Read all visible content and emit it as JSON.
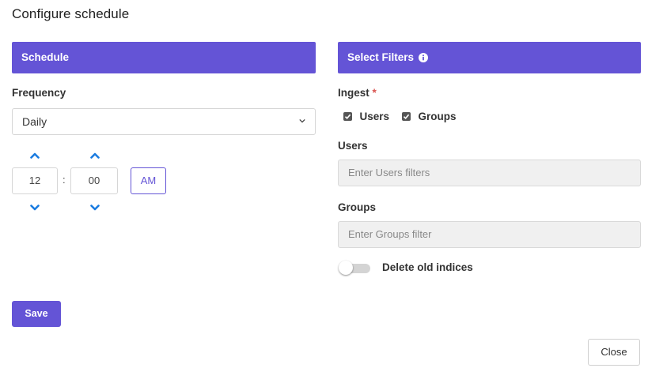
{
  "dialog": {
    "title": "Configure schedule"
  },
  "schedule": {
    "heading": "Schedule",
    "frequency_label": "Frequency",
    "frequency_value": "Daily",
    "hour": "12",
    "separator": ":",
    "minute": "00",
    "meridiem": "AM"
  },
  "filters": {
    "heading": "Select Filters",
    "ingest_label": "Ingest",
    "required_mark": "*",
    "ingest_options": [
      {
        "label": "Users",
        "checked": true
      },
      {
        "label": "Groups",
        "checked": true
      }
    ],
    "users_label": "Users",
    "users_placeholder": "Enter Users filters",
    "groups_label": "Groups",
    "groups_placeholder": "Enter Groups filter",
    "delete_old_label": "Delete old indices",
    "delete_old_enabled": false
  },
  "actions": {
    "save_label": "Save",
    "close_label": "Close"
  },
  "colors": {
    "accent": "#6454d6",
    "spinner": "#1a7be0",
    "required": "#d9534f"
  },
  "icons": {
    "info": "info-circle-icon",
    "dropdown": "chevron-down-icon",
    "increment": "chevron-up-icon",
    "decrement": "chevron-down-icon",
    "check": "checkbox-checked-icon"
  }
}
